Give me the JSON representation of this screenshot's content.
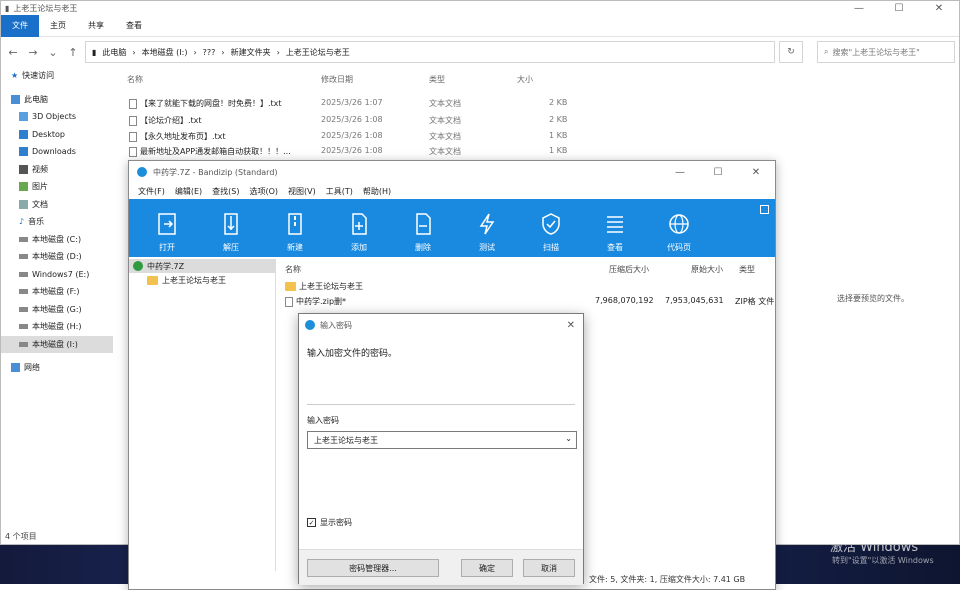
{
  "explorer": {
    "title": "上老王论坛与老王",
    "ribbon": [
      "文件",
      "主页",
      "共享",
      "查看"
    ],
    "path": [
      "此电脑",
      "本地磁盘 (I:)",
      "???",
      "新建文件夹",
      "上老王论坛与老王"
    ],
    "search_placeholder": "搜索\"上老王论坛与老王\"",
    "columns": [
      "名称",
      "修改日期",
      "类型",
      "大小"
    ],
    "files": [
      {
        "name": "【来了就能下载的网盘！时免费！】.txt",
        "date": "2025/3/26 1:07",
        "type": "文本文档",
        "size": "2 KB"
      },
      {
        "name": "【论坛介绍】.txt",
        "date": "2025/3/26 1:08",
        "type": "文本文档",
        "size": "2 KB"
      },
      {
        "name": "【永久地址发布页】.txt",
        "date": "2025/3/26 1:08",
        "type": "文本文档",
        "size": "1 KB"
      },
      {
        "name": "最新地址及APP通发邮箱自动获取！！！...",
        "date": "2025/3/26 1:08",
        "type": "文本文档",
        "size": "1 KB"
      }
    ],
    "sidebar": [
      {
        "label": "快速访问",
        "icon": "star-icon"
      },
      {
        "label": "此电脑",
        "icon": "computer-icon"
      },
      {
        "label": "3D Objects",
        "icon": "cube-icon"
      },
      {
        "label": "Desktop",
        "icon": "desktop-icon"
      },
      {
        "label": "Downloads",
        "icon": "download-icon"
      },
      {
        "label": "视频",
        "icon": "video-icon"
      },
      {
        "label": "图片",
        "icon": "image-icon"
      },
      {
        "label": "文档",
        "icon": "document-icon"
      },
      {
        "label": "音乐",
        "icon": "music-icon"
      },
      {
        "label": "本地磁盘 (C:)",
        "icon": "drive-icon"
      },
      {
        "label": "本地磁盘 (D:)",
        "icon": "drive-icon"
      },
      {
        "label": "Windows7 (E:)",
        "icon": "drive-icon"
      },
      {
        "label": "本地磁盘 (F:)",
        "icon": "drive-icon"
      },
      {
        "label": "本地磁盘 (G:)",
        "icon": "drive-icon"
      },
      {
        "label": "本地磁盘 (H:)",
        "icon": "drive-icon"
      },
      {
        "label": "本地磁盘 (I:)",
        "icon": "drive-icon"
      },
      {
        "label": "网络",
        "icon": "network-icon"
      }
    ],
    "status": "4 个项目",
    "empty_tip": "选择要预览的文件。"
  },
  "bandizip": {
    "title": "中药学.7Z - Bandizip (Standard)",
    "menu": [
      "文件(F)",
      "编辑(E)",
      "查找(S)",
      "选项(O)",
      "视图(V)",
      "工具(T)",
      "帮助(H)"
    ],
    "tools": [
      {
        "label": "打开",
        "icon": "open-icon"
      },
      {
        "label": "解压",
        "icon": "extract-icon"
      },
      {
        "label": "新建",
        "icon": "new-archive-icon"
      },
      {
        "label": "添加",
        "icon": "add-file-icon"
      },
      {
        "label": "删除",
        "icon": "delete-file-icon"
      },
      {
        "label": "测试",
        "icon": "test-icon"
      },
      {
        "label": "扫描",
        "icon": "shield-icon"
      },
      {
        "label": "查看",
        "icon": "list-view-icon"
      },
      {
        "label": "代码页",
        "icon": "globe-icon"
      }
    ],
    "tree": [
      {
        "label": "中药学.7Z"
      },
      {
        "label": "上老王论坛与老王"
      }
    ],
    "columns": [
      "名称",
      "压缩后大小",
      "原始大小",
      "类型"
    ],
    "rows": [
      {
        "name": "上老王论坛与老王",
        "csize": "",
        "osize": "",
        "type": ""
      },
      {
        "name": "中药学.zip删*",
        "csize": "7,968,070,192",
        "osize": "7,953,045,631",
        "type": "ZIP格 文件"
      }
    ],
    "status": "文件: 5, 文件夹: 1, 压缩文件大小: 7.41 GB"
  },
  "password_dialog": {
    "title": "输入密码",
    "prompt": "输入加密文件的密码。",
    "label": "输入密码",
    "value": "上老王论坛与老王",
    "show_password": "显示密码",
    "manager_button": "密码管理器...",
    "ok_button": "确定",
    "cancel_button": "取消"
  },
  "watermark": {
    "line1": "激活 Windows",
    "line2": "转到\"设置\"以激活 Windows"
  },
  "colors": {
    "accent": "#1a8ae0",
    "file_tab": "#1a6fc9",
    "folder": "#f2c14e"
  }
}
